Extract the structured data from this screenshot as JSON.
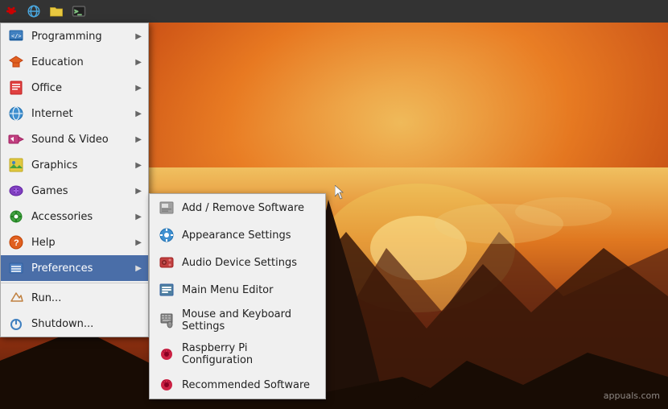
{
  "taskbar": {
    "icons": [
      "raspberry-pi-icon",
      "globe-icon",
      "folder-icon",
      "terminal-icon"
    ]
  },
  "menu": {
    "items": [
      {
        "id": "programming",
        "label": "Programming",
        "icon": "💻",
        "hasArrow": true,
        "active": false
      },
      {
        "id": "education",
        "label": "Education",
        "icon": "🎓",
        "hasArrow": true,
        "active": false
      },
      {
        "id": "office",
        "label": "Office",
        "icon": "📄",
        "hasArrow": true,
        "active": false
      },
      {
        "id": "internet",
        "label": "Internet",
        "icon": "🌐",
        "hasArrow": true,
        "active": false
      },
      {
        "id": "sound-video",
        "label": "Sound & Video",
        "icon": "🎵",
        "hasArrow": true,
        "active": false
      },
      {
        "id": "graphics",
        "label": "Graphics",
        "icon": "🖼️",
        "hasArrow": true,
        "active": false
      },
      {
        "id": "games",
        "label": "Games",
        "icon": "🎮",
        "hasArrow": true,
        "active": false
      },
      {
        "id": "accessories",
        "label": "Accessories",
        "icon": "🔧",
        "hasArrow": true,
        "active": false
      },
      {
        "id": "help",
        "label": "Help",
        "icon": "❓",
        "hasArrow": true,
        "active": false
      },
      {
        "id": "preferences",
        "label": "Preferences",
        "icon": "⚙️",
        "hasArrow": true,
        "active": true
      },
      {
        "id": "run",
        "label": "Run...",
        "icon": "✈️",
        "hasArrow": false,
        "active": false
      },
      {
        "id": "shutdown",
        "label": "Shutdown...",
        "icon": "🏃",
        "hasArrow": false,
        "active": false
      }
    ]
  },
  "submenu": {
    "title": "Preferences",
    "items": [
      {
        "id": "add-remove-software",
        "label": "Add / Remove Software",
        "icon": "📦"
      },
      {
        "id": "appearance-settings",
        "label": "Appearance Settings",
        "icon": "🎨"
      },
      {
        "id": "audio-device-settings",
        "label": "Audio Device Settings",
        "icon": "🔊"
      },
      {
        "id": "main-menu-editor",
        "label": "Main Menu Editor",
        "icon": "📋"
      },
      {
        "id": "mouse-keyboard-settings",
        "label": "Mouse and Keyboard Settings",
        "icon": "⌨️"
      },
      {
        "id": "raspberry-pi-config",
        "label": "Raspberry Pi Configuration",
        "icon": "🍓"
      },
      {
        "id": "recommended-software",
        "label": "Recommended Software",
        "icon": "🍓"
      }
    ]
  },
  "watermark": {
    "text": "appuals.com"
  }
}
